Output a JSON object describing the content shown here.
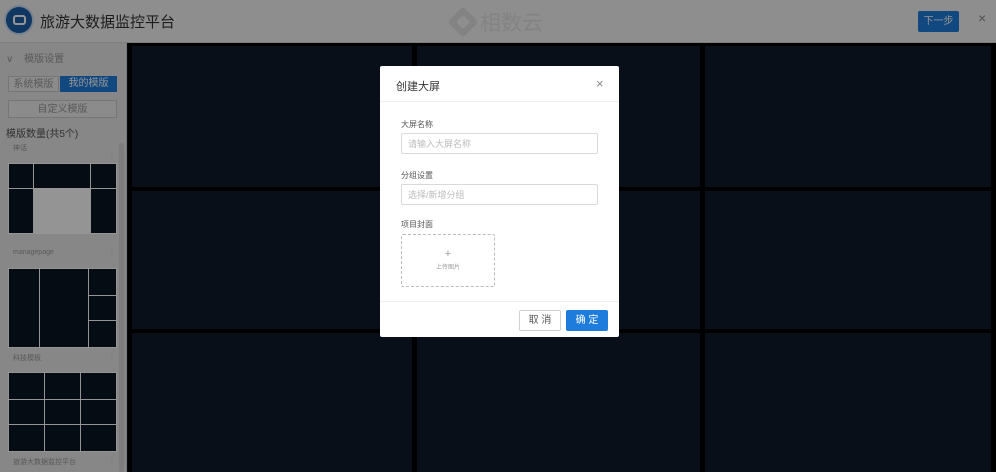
{
  "header": {
    "app_title": "旅游大数据监控平台",
    "brand_name": "相数云",
    "next_label": "下一步",
    "close_symbol": "×"
  },
  "sidebar": {
    "section_title": "模版设置",
    "chevron": "∨",
    "tabs": [
      {
        "label": "系统模版",
        "active": false
      },
      {
        "label": "我的模版",
        "active": true
      }
    ],
    "custom_label": "自定义模版",
    "count_label": "模版数量(共5个)",
    "templates": [
      {
        "name": "神话"
      },
      {
        "name": "managepage"
      },
      {
        "name": "科技模板"
      },
      {
        "name": "旅游大数据监控平台"
      }
    ],
    "more_symbol": "⋮"
  },
  "dialog": {
    "title": "创建大屏",
    "close_symbol": "×",
    "name_label": "大屏名称",
    "name_placeholder": "请输入大屏名称",
    "name_value": "",
    "group_label": "分组设置",
    "group_placeholder": "选择/新增分组",
    "group_value": "",
    "cover_label": "项目封面",
    "upload_plus": "+",
    "upload_text": "上传图片",
    "cancel_label": "取 消",
    "confirm_label": "确 定"
  },
  "colors": {
    "accent": "#1e7cdc",
    "canvas_cell": "#0f1a2a",
    "header_bg": "#f4f4f4"
  }
}
